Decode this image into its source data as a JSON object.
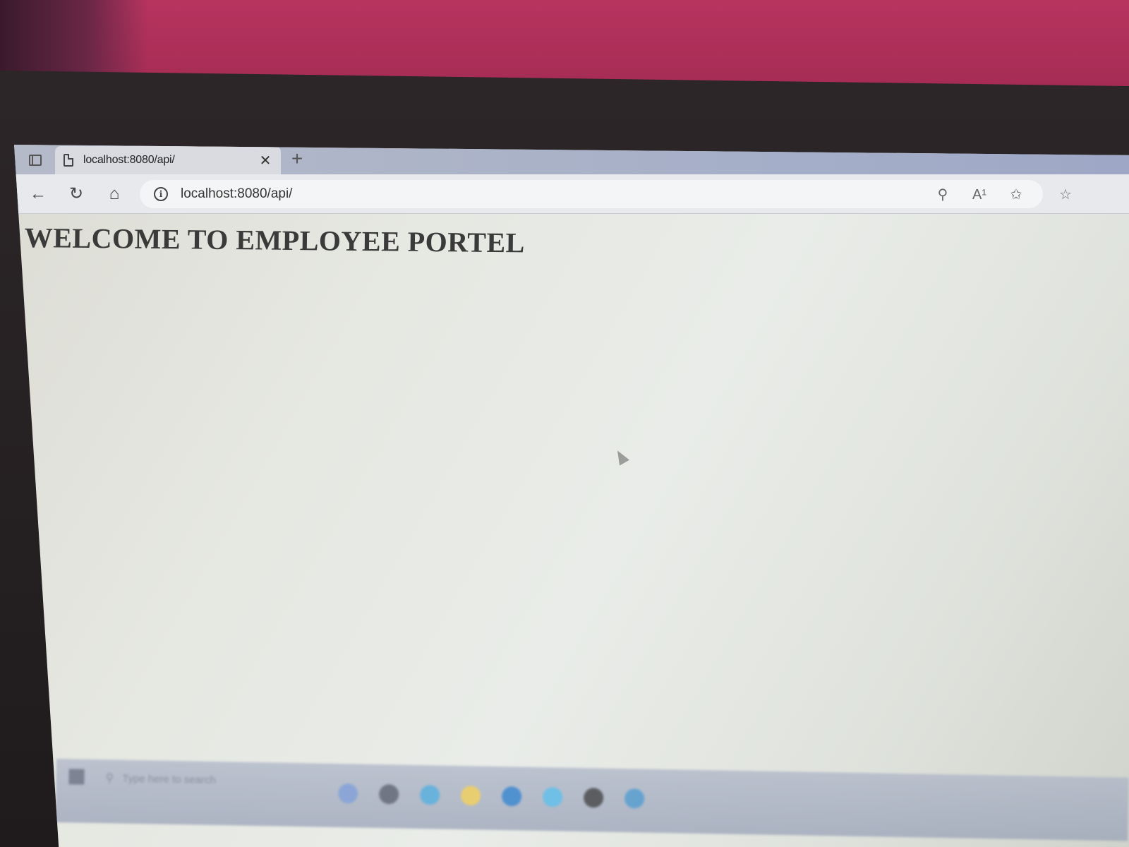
{
  "browser": {
    "tab": {
      "title": "localhost:8080/api/",
      "close_glyph": "✕"
    },
    "new_tab_glyph": "+",
    "address": {
      "url": "localhost:8080/api/"
    },
    "nav": {
      "back_glyph": "←",
      "refresh_glyph": "↻",
      "home_glyph": "⌂"
    },
    "tools": {
      "key_glyph": "⚲",
      "read_aloud_glyph": "A¹",
      "favorites_glyph": "✩",
      "collections_glyph": "☆"
    },
    "icons": [
      "tab-actions-icon",
      "page-icon",
      "close-icon",
      "plus-icon",
      "back-icon",
      "refresh-icon",
      "home-icon",
      "info-icon"
    ]
  },
  "page": {
    "heading": "WELCOME TO EMPLOYEE PORTEL"
  },
  "taskbar": {
    "search_placeholder": "Type here to search",
    "search_glyph": "⚲",
    "app_icon_colors": [
      "#6d8fd1",
      "#4a5063",
      "#3ea0d8",
      "#e8c44a",
      "#1e73c8",
      "#47b1e8",
      "#2d2f35",
      "#3c8cc9"
    ]
  }
}
